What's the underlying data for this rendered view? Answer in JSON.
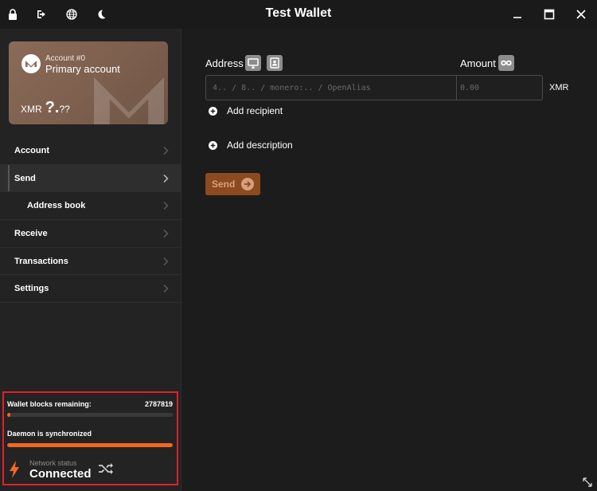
{
  "window": {
    "title": "Test Wallet"
  },
  "titlebar": {
    "left_icons": [
      "lock-icon",
      "logout-icon",
      "globe-icon",
      "moon-icon"
    ],
    "right_controls": [
      "minimize-icon",
      "maximize-icon",
      "close-icon"
    ]
  },
  "account_card": {
    "account_number": "Account #0",
    "account_name": "Primary account",
    "currency": "XMR",
    "balance_big": "?.",
    "balance_small": "??",
    "logo": "monero-logo"
  },
  "sidebar": {
    "items": [
      {
        "label": "Account",
        "active": false,
        "sub": false
      },
      {
        "label": "Send",
        "active": true,
        "sub": false
      },
      {
        "label": "Address book",
        "active": false,
        "sub": true
      },
      {
        "label": "Receive",
        "active": false,
        "sub": false
      },
      {
        "label": "Transactions",
        "active": false,
        "sub": false
      },
      {
        "label": "Settings",
        "active": false,
        "sub": false
      }
    ]
  },
  "status": {
    "blocks_label": "Wallet blocks remaining:",
    "blocks_value": "2787819",
    "blocks_progress": 0.02,
    "daemon_label": "Daemon is synchronized",
    "daemon_progress": 1.0,
    "network_label": "Network status",
    "network_value": "Connected"
  },
  "send_form": {
    "address_label": "Address",
    "address_placeholder": "4.. / 8.. / monero:.. / OpenAlias",
    "amount_label": "Amount",
    "amount_placeholder": "0.00",
    "unit": "XMR",
    "add_recipient": "Add recipient",
    "add_description": "Add description",
    "send_label": "Send"
  },
  "colors": {
    "accent": "#f26822",
    "status_border": "#e0202a",
    "send_button_bg": "#8b4a1f",
    "background": "#1c1c1c",
    "sidebar_bg": "#232323"
  }
}
